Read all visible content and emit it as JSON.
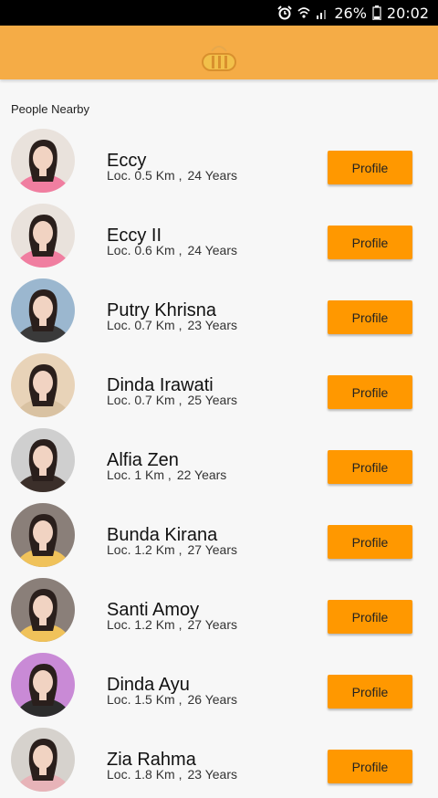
{
  "status_bar": {
    "battery_percent": "26%",
    "time": "20:02",
    "icons": [
      "alarm-icon",
      "wifi-icon",
      "signal-icon",
      "battery-icon"
    ]
  },
  "app_bar": {
    "logo_icon": "app-logo-icon",
    "color": "#f5ac46"
  },
  "section_title": "People Nearby",
  "button_color": "#ff9800",
  "people": [
    {
      "name": "Eccy",
      "distance": "Loc. 0.5 Km ,",
      "age": "24 Years",
      "button": "Profile",
      "avatar_bg": "#e9e2dc",
      "avatar_accent": "#f07ea0"
    },
    {
      "name": "Eccy II",
      "distance": "Loc. 0.6 Km ,",
      "age": "24 Years",
      "button": "Profile",
      "avatar_bg": "#e9e2dc",
      "avatar_accent": "#f07ea0"
    },
    {
      "name": "Putry Khrisna",
      "distance": "Loc. 0.7 Km ,",
      "age": "23 Years",
      "button": "Profile",
      "avatar_bg": "#9bb7cf",
      "avatar_accent": "#3a3a3a"
    },
    {
      "name": "Dinda Irawati",
      "distance": "Loc. 0.7 Km ,",
      "age": "25 Years",
      "button": "Profile",
      "avatar_bg": "#e8d3b8",
      "avatar_accent": "#d9c2a2"
    },
    {
      "name": "Alfia Zen",
      "distance": "Loc. 1 Km ,",
      "age": "22 Years",
      "button": "Profile",
      "avatar_bg": "#cfcfcf",
      "avatar_accent": "#3b2f2a"
    },
    {
      "name": "Bunda Kirana",
      "distance": "Loc. 1.2 Km ,",
      "age": "27 Years",
      "button": "Profile",
      "avatar_bg": "#8a7f79",
      "avatar_accent": "#f0c25a"
    },
    {
      "name": "Santi Amoy",
      "distance": "Loc. 1.2 Km ,",
      "age": "27 Years",
      "button": "Profile",
      "avatar_bg": "#8a7f79",
      "avatar_accent": "#f0c25a"
    },
    {
      "name": "Dinda Ayu",
      "distance": "Loc. 1.5 Km ,",
      "age": "26 Years",
      "button": "Profile",
      "avatar_bg": "#c98ad6",
      "avatar_accent": "#2c2c2c"
    },
    {
      "name": "Zia Rahma",
      "distance": "Loc. 1.8 Km ,",
      "age": "23 Years",
      "button": "Profile",
      "avatar_bg": "#d6d2cd",
      "avatar_accent": "#e7b3b8"
    }
  ]
}
